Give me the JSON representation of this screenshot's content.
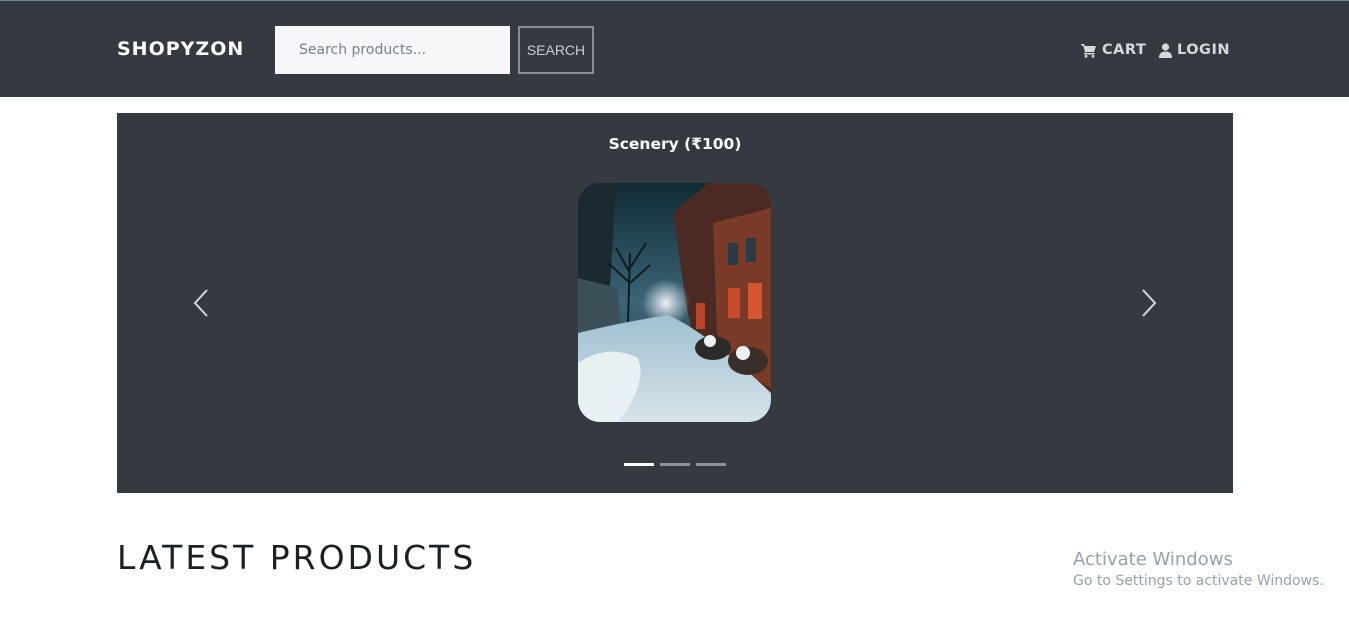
{
  "navbar": {
    "brand": "SHOPYZON",
    "search": {
      "placeholder": "Search products...",
      "value": ""
    },
    "search_button": "SEARCH",
    "cart_label": "CART",
    "login_label": "LOGIN",
    "cart_icon": "cart-icon",
    "login_icon": "user-icon"
  },
  "carousel": {
    "caption": "Scenery (₹100)",
    "active_index": 0,
    "indicator_count": 3,
    "prev_icon": "chevron-left-icon",
    "next_icon": "chevron-right-icon"
  },
  "main": {
    "section_title": "LATEST PRODUCTS"
  },
  "watermark": {
    "line1": "Activate Windows",
    "line2": "Go to Settings to activate Windows."
  },
  "colors": {
    "navbar_bg": "#343a40",
    "carousel_bg": "#343a40",
    "page_bg": "#ffffff"
  }
}
